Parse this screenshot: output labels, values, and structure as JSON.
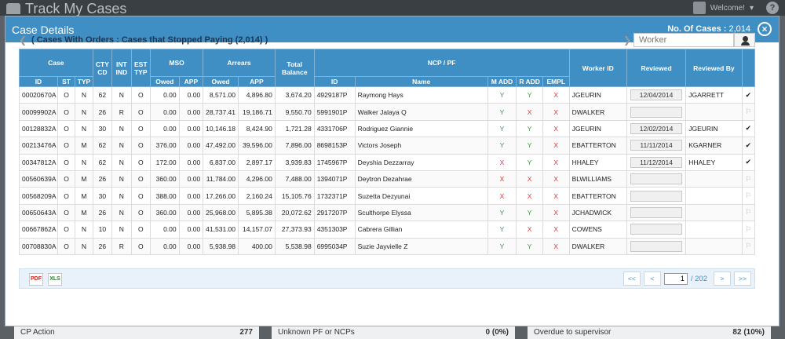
{
  "app": {
    "title": "Track My Cases",
    "welcome": "Welcome!",
    "help": "?"
  },
  "background_stats": [
    {
      "label": "CP Action",
      "value": "277"
    },
    {
      "label": "Unknown PF or NCPs",
      "value": "0 (0%)"
    },
    {
      "label": "Overdue to supervisor",
      "value": "82 (10%)"
    }
  ],
  "modal": {
    "title": "Case Details",
    "count_label": "No. Of Cases :",
    "count_value": "2,014",
    "case_title": "( Cases With Orders : Cases that Stopped Paying (2,014) )",
    "worker_placeholder": "Worker"
  },
  "columns": {
    "groups": [
      "Case",
      "CTY CD",
      "INT IND",
      "EST TYP",
      "MSO",
      "Arrears",
      "Total Balance",
      "NCP / PF",
      "Worker ID",
      "Reviewed",
      "Reviewed By"
    ],
    "sub": [
      "ID",
      "ST",
      "TYP",
      "Owed",
      "APP",
      "Owed",
      "APP",
      "ID",
      "Name",
      "M ADD",
      "R ADD",
      "EMPL"
    ]
  },
  "rows": [
    {
      "id": "00020670A",
      "st": "O",
      "typ": "N",
      "cty": "62",
      "int": "N",
      "est": "O",
      "mso_owed": "0.00",
      "mso_app": "0.00",
      "arr_owed": "8,571.00",
      "arr_app": "4,896.80",
      "total": "3,674.20",
      "ncp_id": "4929187P",
      "name": "Raymong Hays",
      "madd": "Y",
      "radd": "Y",
      "empl": "X",
      "worker": "JGEURIN",
      "reviewed": "12/04/2014",
      "by": "JGARRETT",
      "status": "done"
    },
    {
      "id": "00099902A",
      "st": "O",
      "typ": "N",
      "cty": "26",
      "int": "R",
      "est": "O",
      "mso_owed": "0.00",
      "mso_app": "0.00",
      "arr_owed": "28,737.41",
      "arr_app": "19,186.71",
      "total": "9,550.70",
      "ncp_id": "5991901P",
      "name": "Walker Jalaya Q",
      "madd": "Y",
      "radd": "X",
      "empl": "X",
      "worker": "DWALKER",
      "reviewed": "",
      "by": "",
      "status": "flag"
    },
    {
      "id": "00128832A",
      "st": "O",
      "typ": "N",
      "cty": "30",
      "int": "N",
      "est": "O",
      "mso_owed": "0.00",
      "mso_app": "0.00",
      "arr_owed": "10,146.18",
      "arr_app": "8,424.90",
      "total": "1,721.28",
      "ncp_id": "4331706P",
      "name": "Rodriguez Giannie",
      "madd": "Y",
      "radd": "Y",
      "empl": "X",
      "worker": "JGEURIN",
      "reviewed": "12/02/2014",
      "by": "JGEURIN",
      "status": "done"
    },
    {
      "id": "00213476A",
      "st": "O",
      "typ": "M",
      "cty": "62",
      "int": "N",
      "est": "O",
      "mso_owed": "376.00",
      "mso_app": "0.00",
      "arr_owed": "47,492.00",
      "arr_app": "39,596.00",
      "total": "7,896.00",
      "ncp_id": "8698153P",
      "name": "Victors Joseph",
      "madd": "Y",
      "radd": "Y",
      "empl": "X",
      "worker": "EBATTERTON",
      "reviewed": "11/11/2014",
      "by": "KGARNER",
      "status": "done"
    },
    {
      "id": "00347812A",
      "st": "O",
      "typ": "N",
      "cty": "62",
      "int": "N",
      "est": "O",
      "mso_owed": "172.00",
      "mso_app": "0.00",
      "arr_owed": "6,837.00",
      "arr_app": "2,897.17",
      "total": "3,939.83",
      "ncp_id": "1745967P",
      "name": "Deyshia Dezzarray",
      "madd": "X",
      "radd": "Y",
      "empl": "X",
      "worker": "HHALEY",
      "reviewed": "11/12/2014",
      "by": "HHALEY",
      "status": "done"
    },
    {
      "id": "00560639A",
      "st": "O",
      "typ": "M",
      "cty": "26",
      "int": "N",
      "est": "O",
      "mso_owed": "360.00",
      "mso_app": "0.00",
      "arr_owed": "11,784.00",
      "arr_app": "4,296.00",
      "total": "7,488.00",
      "ncp_id": "1394071P",
      "name": "Deytron Dezahrae",
      "madd": "X",
      "radd": "X",
      "empl": "X",
      "worker": "BLWILLIAMS",
      "reviewed": "",
      "by": "",
      "status": "flag"
    },
    {
      "id": "00568209A",
      "st": "O",
      "typ": "M",
      "cty": "30",
      "int": "N",
      "est": "O",
      "mso_owed": "388.00",
      "mso_app": "0.00",
      "arr_owed": "17,266.00",
      "arr_app": "2,160.24",
      "total": "15,105.76",
      "ncp_id": "1732371P",
      "name": "Suzetta Dezyunai",
      "madd": "X",
      "radd": "X",
      "empl": "X",
      "worker": "EBATTERTON",
      "reviewed": "",
      "by": "",
      "status": "flag"
    },
    {
      "id": "00650643A",
      "st": "O",
      "typ": "M",
      "cty": "26",
      "int": "N",
      "est": "O",
      "mso_owed": "360.00",
      "mso_app": "0.00",
      "arr_owed": "25,968.00",
      "arr_app": "5,895.38",
      "total": "20,072.62",
      "ncp_id": "2917207P",
      "name": "Sculthorpe Elyssa",
      "madd": "Y",
      "radd": "Y",
      "empl": "X",
      "worker": "JCHADWICK",
      "reviewed": "",
      "by": "",
      "status": "flag"
    },
    {
      "id": "00667862A",
      "st": "O",
      "typ": "N",
      "cty": "10",
      "int": "N",
      "est": "O",
      "mso_owed": "0.00",
      "mso_app": "0.00",
      "arr_owed": "41,531.00",
      "arr_app": "14,157.07",
      "total": "27,373.93",
      "ncp_id": "4351303P",
      "name": "Cabrera Gillian",
      "madd": "Y",
      "radd": "X",
      "empl": "X",
      "worker": "COWENS",
      "reviewed": "",
      "by": "",
      "status": "flag"
    },
    {
      "id": "00708830A",
      "st": "O",
      "typ": "N",
      "cty": "26",
      "int": "R",
      "est": "O",
      "mso_owed": "0.00",
      "mso_app": "0.00",
      "arr_owed": "5,938.98",
      "arr_app": "400.00",
      "total": "5,538.98",
      "ncp_id": "6995034P",
      "name": "Suzie Jayvielle Z",
      "madd": "Y",
      "radd": "Y",
      "empl": "X",
      "worker": "DWALKER",
      "reviewed": "",
      "by": "",
      "status": "flag"
    }
  ],
  "pager": {
    "first": "<<",
    "prev": "<",
    "page": "1",
    "total": "/ 202",
    "next": ">",
    "last": ">>"
  },
  "icons": {
    "done": "✔",
    "flag": "⚐"
  }
}
